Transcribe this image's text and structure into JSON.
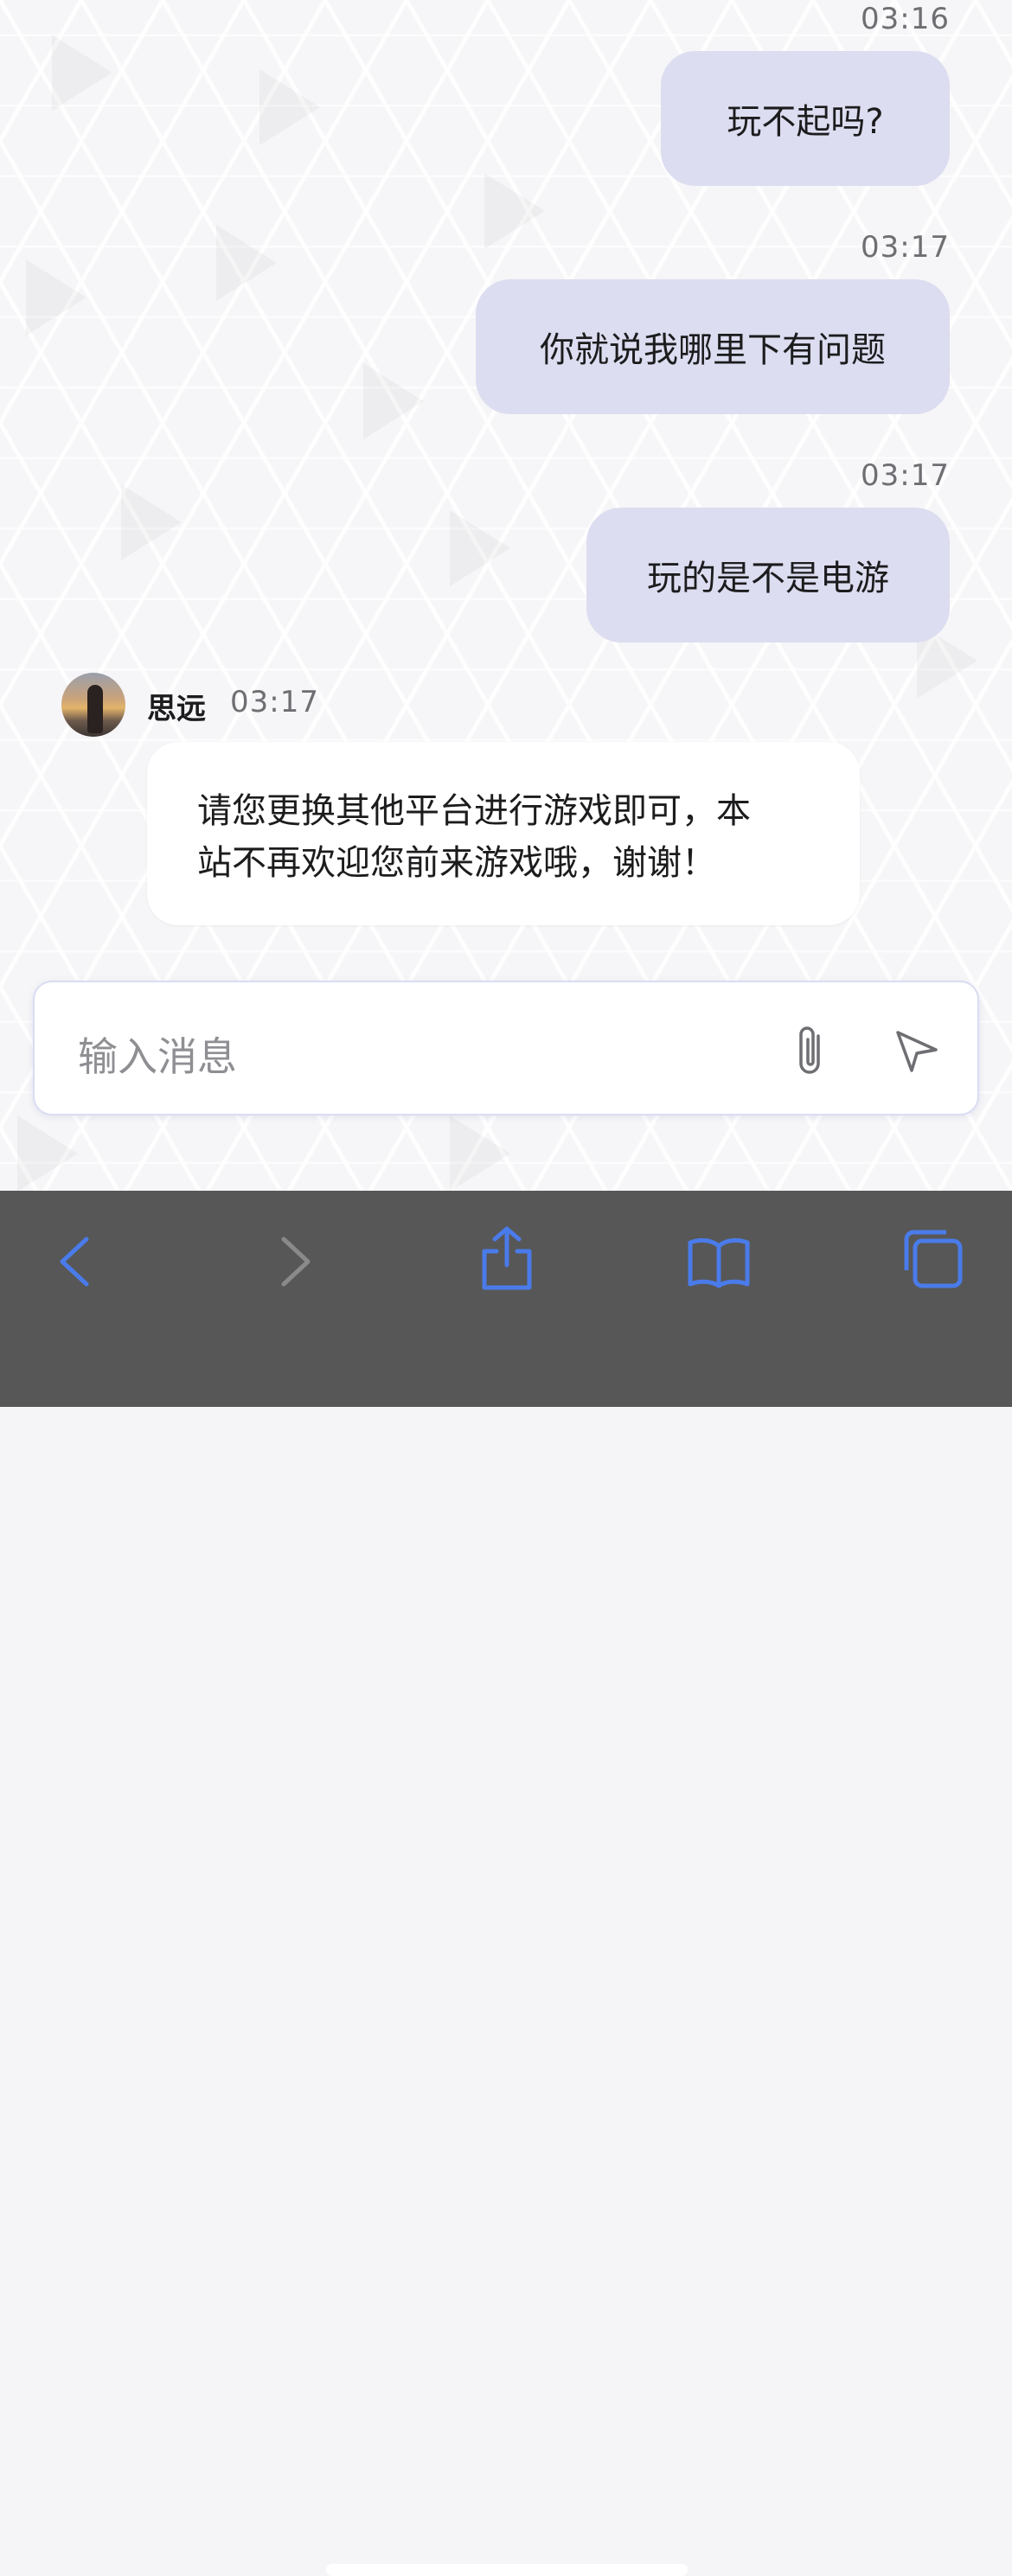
{
  "messages": [
    {
      "direction": "outgoing",
      "time": "03:16",
      "text": "玩不起吗?"
    },
    {
      "direction": "outgoing",
      "time": "03:17",
      "text": "你就说我哪里下有问题"
    },
    {
      "direction": "outgoing",
      "time": "03:17",
      "text": "玩的是不是电游"
    },
    {
      "direction": "incoming",
      "sender": "思远",
      "time": "03:17",
      "text": "请您更换其他平台进行游戏即可，本站不再欢迎您前来游戏哦，谢谢！",
      "line1": "请您更换其他平台进行游戏即可，本",
      "line2": "站不再欢迎您前来游戏哦，谢谢！"
    }
  ],
  "composer": {
    "placeholder": "输入消息",
    "attach_icon": "paperclip-icon",
    "send_icon": "send-icon"
  },
  "toolbar": {
    "icons": [
      "back-icon",
      "forward-icon",
      "share-icon",
      "bookmarks-icon",
      "tabs-icon"
    ],
    "accent": "#4a7bea",
    "disabled": "#8a8a8a"
  },
  "colors": {
    "outgoing_bubble": "#dcddf0",
    "incoming_bubble": "#ffffff",
    "toolbar_bg": "#575757"
  }
}
